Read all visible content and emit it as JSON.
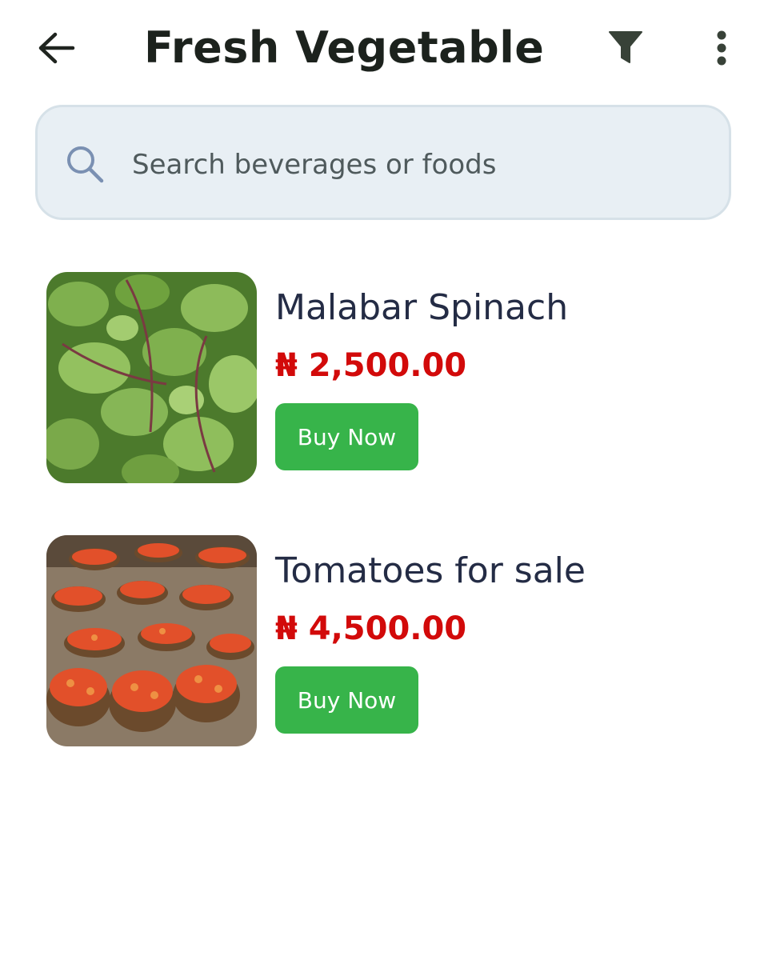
{
  "header": {
    "title": "Fresh Vegetable",
    "back_icon": "arrow-left-icon",
    "filter_icon": "filter-icon",
    "more_icon": "more-vertical-icon"
  },
  "search": {
    "placeholder": "Search beverages or foods",
    "value": "",
    "icon": "search-icon"
  },
  "products": [
    {
      "name": "Malabar Spinach",
      "price": "₦ 2,500.00",
      "button_label": "Buy Now",
      "image": "malabar-spinach-photo"
    },
    {
      "name": "Tomatoes for sale",
      "price": "₦ 4,500.00",
      "button_label": "Buy Now",
      "image": "tomato-baskets-photo"
    }
  ],
  "colors": {
    "title": "#1c221d",
    "search_background": "#e8eff4",
    "product_name": "#242c45",
    "price": "#d20a0a",
    "buy_button": "#37b44a"
  }
}
